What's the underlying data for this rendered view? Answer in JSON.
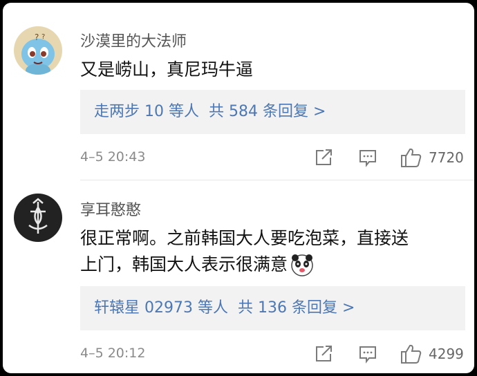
{
  "comments": [
    {
      "username": "沙漠里的大法师",
      "text": "又是崂山，真尼玛牛逼",
      "replies_prefix": "走两步 10 等人  ",
      "replies_total": "共 584 条回复 >",
      "time": "4–5 20:43",
      "likes": "7720"
    },
    {
      "username": "享耳憨憨",
      "text_line1": "很正常啊。之前韩国大人要吃泡菜，直接送",
      "text_line2": "上门，韩国大人表示很满意",
      "replies_prefix": "轩辕星 02973 等人  ",
      "replies_total": "共 136 条回复 >",
      "time": "4–5 20:12",
      "likes": "4299"
    }
  ],
  "icons": {
    "share": "share-icon",
    "reply": "comment-icon",
    "like": "thumbs-up-icon"
  },
  "colors": {
    "link": "#4d77b3",
    "reply_bg": "#f2f2f2",
    "muted": "#8a8a8a"
  }
}
